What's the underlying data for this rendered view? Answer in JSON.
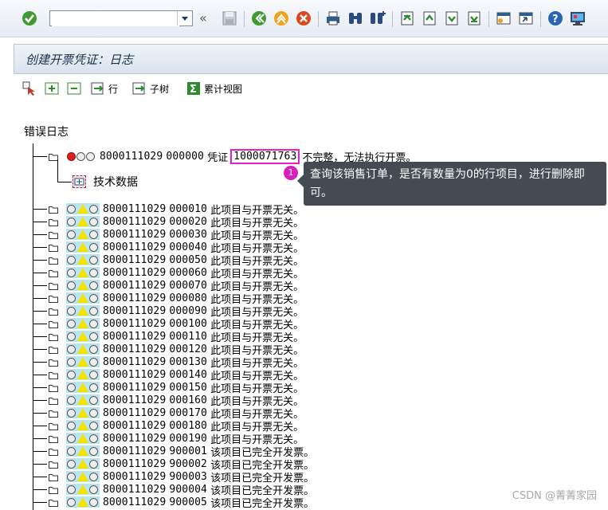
{
  "toolbar": {
    "command_value": "",
    "icons": [
      "check-icon",
      "dropdown-icon",
      "history-back-icon",
      "save-icon",
      "back-icon",
      "exit-icon",
      "cancel-icon",
      "print-icon",
      "find-icon",
      "find-next-icon",
      "first-page-icon",
      "prev-page-icon",
      "next-page-icon",
      "last-page-icon",
      "new-session-icon",
      "shortcut-icon",
      "help-icon",
      "customize-icon"
    ]
  },
  "title": "创建开票凭证：日志",
  "app_toolbar": {
    "row_label": "行",
    "subtree_label": "子树",
    "cumulative_label": "累计视图"
  },
  "tree": {
    "title": "错误日志",
    "error_row": {
      "doc": "8000111029",
      "item": "000000",
      "prefix": "凭证",
      "highlight": "1000071763",
      "suffix": "不完整，无法执行开票。"
    },
    "tech_data": "技术数据",
    "rows": [
      {
        "doc": "8000111029",
        "item": "000010",
        "msg": "此项目与开票无关。"
      },
      {
        "doc": "8000111029",
        "item": "000020",
        "msg": "此项目与开票无关。"
      },
      {
        "doc": "8000111029",
        "item": "000030",
        "msg": "此项目与开票无关。"
      },
      {
        "doc": "8000111029",
        "item": "000040",
        "msg": "此项目与开票无关。"
      },
      {
        "doc": "8000111029",
        "item": "000050",
        "msg": "此项目与开票无关。"
      },
      {
        "doc": "8000111029",
        "item": "000060",
        "msg": "此项目与开票无关。"
      },
      {
        "doc": "8000111029",
        "item": "000070",
        "msg": "此项目与开票无关。"
      },
      {
        "doc": "8000111029",
        "item": "000080",
        "msg": "此项目与开票无关。"
      },
      {
        "doc": "8000111029",
        "item": "000090",
        "msg": "此项目与开票无关。"
      },
      {
        "doc": "8000111029",
        "item": "000100",
        "msg": "此项目与开票无关。"
      },
      {
        "doc": "8000111029",
        "item": "000110",
        "msg": "此项目与开票无关。"
      },
      {
        "doc": "8000111029",
        "item": "000120",
        "msg": "此项目与开票无关。"
      },
      {
        "doc": "8000111029",
        "item": "000130",
        "msg": "此项目与开票无关。"
      },
      {
        "doc": "8000111029",
        "item": "000140",
        "msg": "此项目与开票无关。"
      },
      {
        "doc": "8000111029",
        "item": "000150",
        "msg": "此项目与开票无关。"
      },
      {
        "doc": "8000111029",
        "item": "000160",
        "msg": "此项目与开票无关。"
      },
      {
        "doc": "8000111029",
        "item": "000170",
        "msg": "此项目与开票无关。"
      },
      {
        "doc": "8000111029",
        "item": "000180",
        "msg": "此项目与开票无关。"
      },
      {
        "doc": "8000111029",
        "item": "000190",
        "msg": "此项目与开票无关。"
      },
      {
        "doc": "8000111029",
        "item": "900001",
        "msg": "该项目已完全开发票。"
      },
      {
        "doc": "8000111029",
        "item": "900002",
        "msg": "该项目已完全开发票。"
      },
      {
        "doc": "8000111029",
        "item": "900003",
        "msg": "该项目已完全开发票。"
      },
      {
        "doc": "8000111029",
        "item": "900004",
        "msg": "该项目已完全开发票。"
      },
      {
        "doc": "8000111029",
        "item": "900005",
        "msg": "该项目已完全开发票。"
      }
    ]
  },
  "annotation": {
    "badge": "1",
    "text": "查询该销售订单，是否有数量为0的行项目，进行删除即可。"
  },
  "watermark": "CSDN @菁菁家园",
  "colors": {
    "error_red": "#e31d1d",
    "warning_yellow": "#f5e400",
    "highlight": "#e020c8",
    "tooltip_bg": "#454b52"
  }
}
